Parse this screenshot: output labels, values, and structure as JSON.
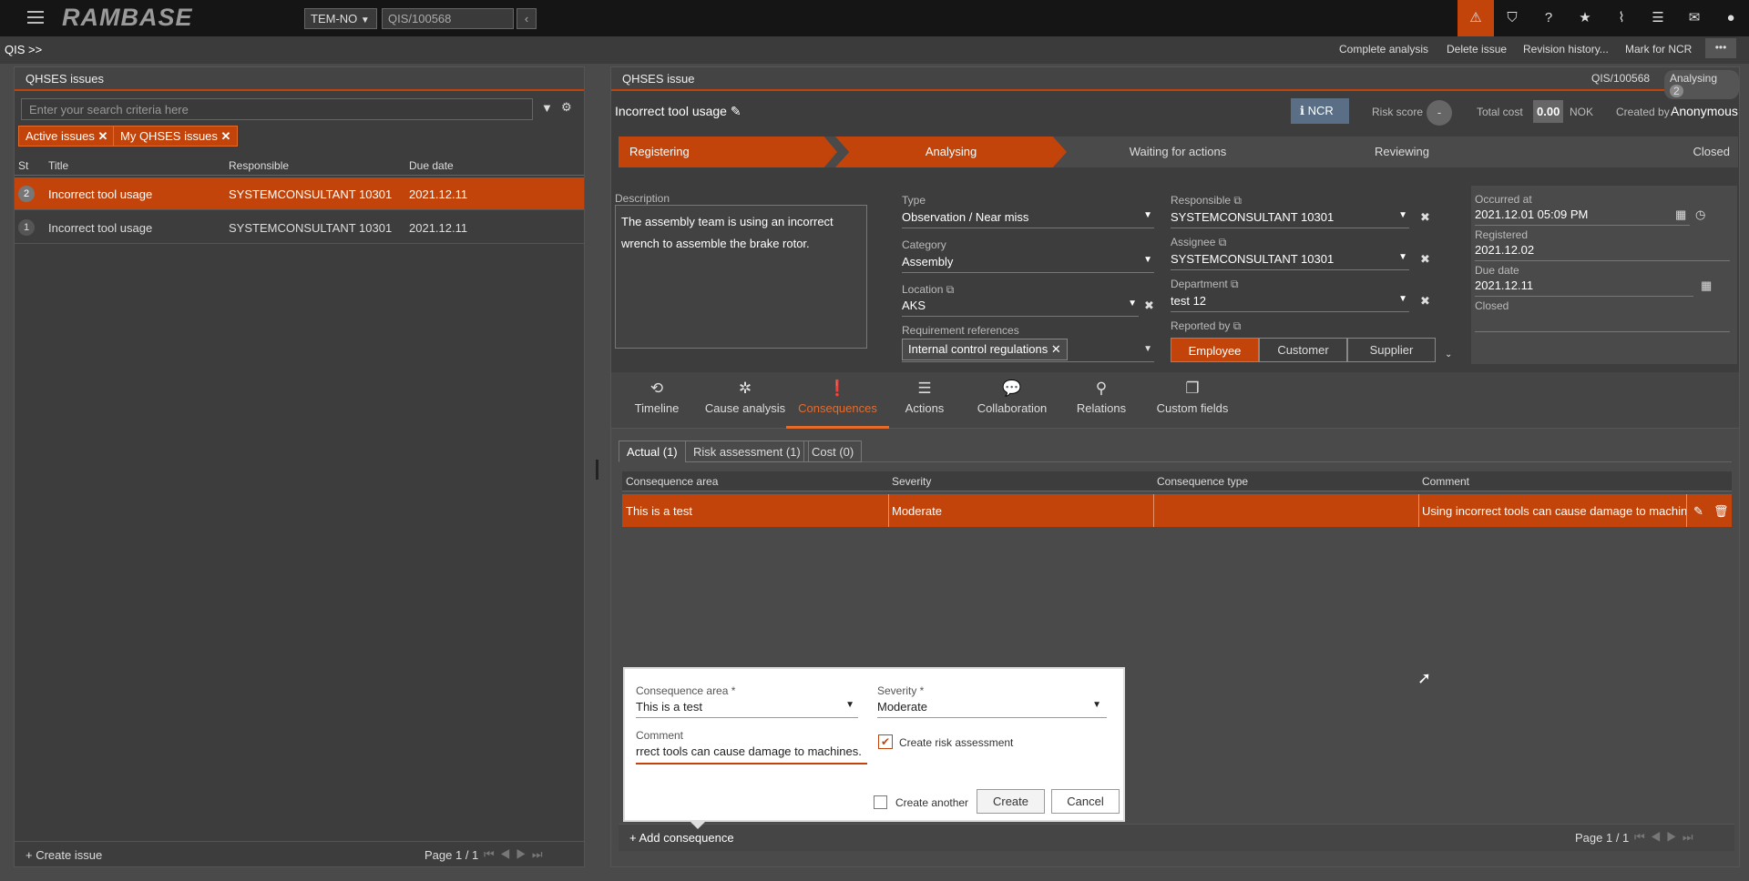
{
  "topbar": {
    "company": "TEM-NO",
    "doc_search": "QIS/100568",
    "logo": "RAMBASE"
  },
  "breadcrumb": {
    "path": "QIS >>"
  },
  "actions": [
    "Complete analysis",
    "Delete issue",
    "Revision history...",
    "Mark for NCR"
  ],
  "left": {
    "title": "QHSES issues",
    "search_placeholder": "Enter your search criteria here",
    "chips": [
      "Active issues",
      "My QHSES issues"
    ],
    "columns": [
      "St",
      "Title",
      "Responsible",
      "Due date"
    ],
    "rows": [
      {
        "st": "2",
        "title": "Incorrect tool usage",
        "responsible": "SYSTEMCONSULTANT 10301",
        "due": "2021.12.11"
      },
      {
        "st": "1",
        "title": "Incorrect tool usage",
        "responsible": "SYSTEMCONSULTANT 10301",
        "due": "2021.12.11"
      }
    ],
    "create": "Create issue",
    "page": "Page 1 / 1"
  },
  "right": {
    "title": "QHSES issue",
    "doc_id": "QIS/100568",
    "status": "Analysing",
    "status_count": "2",
    "issue_title": "Incorrect tool usage",
    "ncr": "NCR",
    "risk_label": "Risk score",
    "risk_value": "-",
    "cost_label": "Total cost",
    "cost_value": "0.00",
    "currency": "NOK",
    "created_by_label": "Created by",
    "created_by": "Anonymous",
    "steps": [
      "Registering",
      "Analysing",
      "Waiting for actions",
      "Reviewing",
      "Closed"
    ],
    "description_label": "Description",
    "description": "The assembly team is using an incorrect wrench to assemble the brake rotor.",
    "type_label": "Type",
    "type": "Observation / Near miss",
    "category_label": "Category",
    "category": "Assembly",
    "location_label": "Location",
    "location": "AKS",
    "reqref_label": "Requirement references",
    "reqref": "Internal control regulations",
    "responsible_label": "Responsible",
    "responsible": "SYSTEMCONSULTANT 10301",
    "assignee_label": "Assignee",
    "assignee": "SYSTEMCONSULTANT 10301",
    "department_label": "Department",
    "department": "test 12",
    "reported_label": "Reported by",
    "reported_opts": [
      "Employee",
      "Customer",
      "Supplier"
    ],
    "occurred_label": "Occurred at",
    "occurred": "2021.12.01 05:09 PM",
    "registered_label": "Registered",
    "registered": "2021.12.02",
    "due_label": "Due date",
    "due": "2021.12.11",
    "closed_label": "Closed",
    "tabs": [
      "Timeline",
      "Cause analysis",
      "Consequences",
      "Actions",
      "Collaboration",
      "Relations",
      "Custom fields"
    ],
    "subtabs": [
      "Actual (1)",
      "Risk assessment (1)",
      "Cost (0)"
    ],
    "grid_cols": [
      "Consequence area",
      "Severity",
      "Consequence type",
      "Comment"
    ],
    "grid_row": {
      "area": "This is a test",
      "severity": "Moderate",
      "type": "",
      "comment": "Using incorrect tools can cause damage to machin"
    },
    "add": "Add consequence",
    "page": "Page 1 / 1"
  },
  "dialog": {
    "area_label": "Consequence area *",
    "area": "This is a test",
    "severity_label": "Severity *",
    "severity": "Moderate",
    "comment_label": "Comment",
    "comment": "rrect tools can cause damage to machines.",
    "risk_check": "Create risk assessment",
    "another": "Create another",
    "create": "Create",
    "cancel": "Cancel"
  },
  "colors": {
    "accent": "#c2440a",
    "topbar": "#151515",
    "panel": "#3d3d3d"
  }
}
